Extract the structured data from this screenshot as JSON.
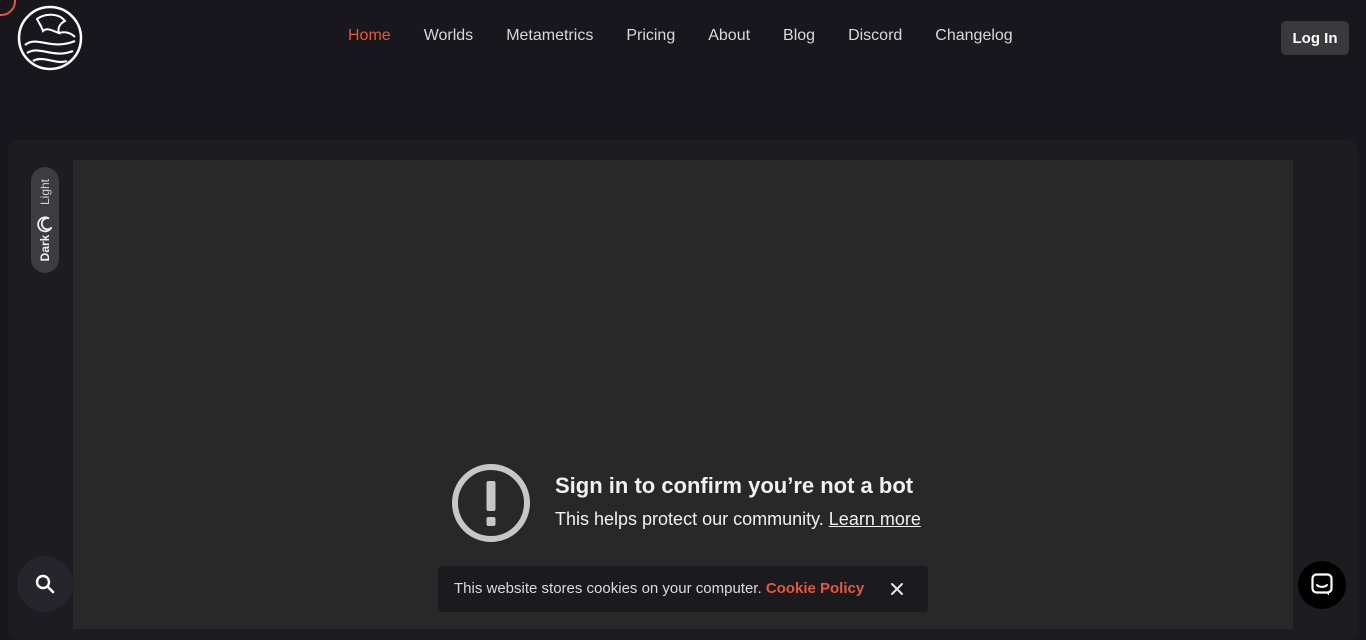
{
  "header": {
    "nav": [
      {
        "label": "Home",
        "active": true
      },
      {
        "label": "Worlds"
      },
      {
        "label": "Metametrics"
      },
      {
        "label": "Pricing"
      },
      {
        "label": "About"
      },
      {
        "label": "Blog"
      },
      {
        "label": "Discord"
      },
      {
        "label": "Changelog"
      }
    ],
    "login_label": "Log In",
    "logo_icon": "dragon-logo-icon"
  },
  "theme_toggle": {
    "light_label": "Light",
    "dark_label": "Dark",
    "icon": "moon-icon",
    "selected": "Dark"
  },
  "video": {
    "title": "Sign in to confirm you’re not a bot",
    "subtitle": "This helps protect our community.",
    "learn_more": "Learn more",
    "icon": "exclamation-circle-icon"
  },
  "cookie": {
    "message": "This website stores cookies on your computer.",
    "policy_link": "Cookie Policy",
    "close_icon": "close-icon"
  },
  "floating": {
    "search_icon": "search-icon",
    "chat_icon": "chat-icon"
  },
  "colors": {
    "accent": "#e8573a",
    "background": "#18171d",
    "panel": "#282828"
  }
}
